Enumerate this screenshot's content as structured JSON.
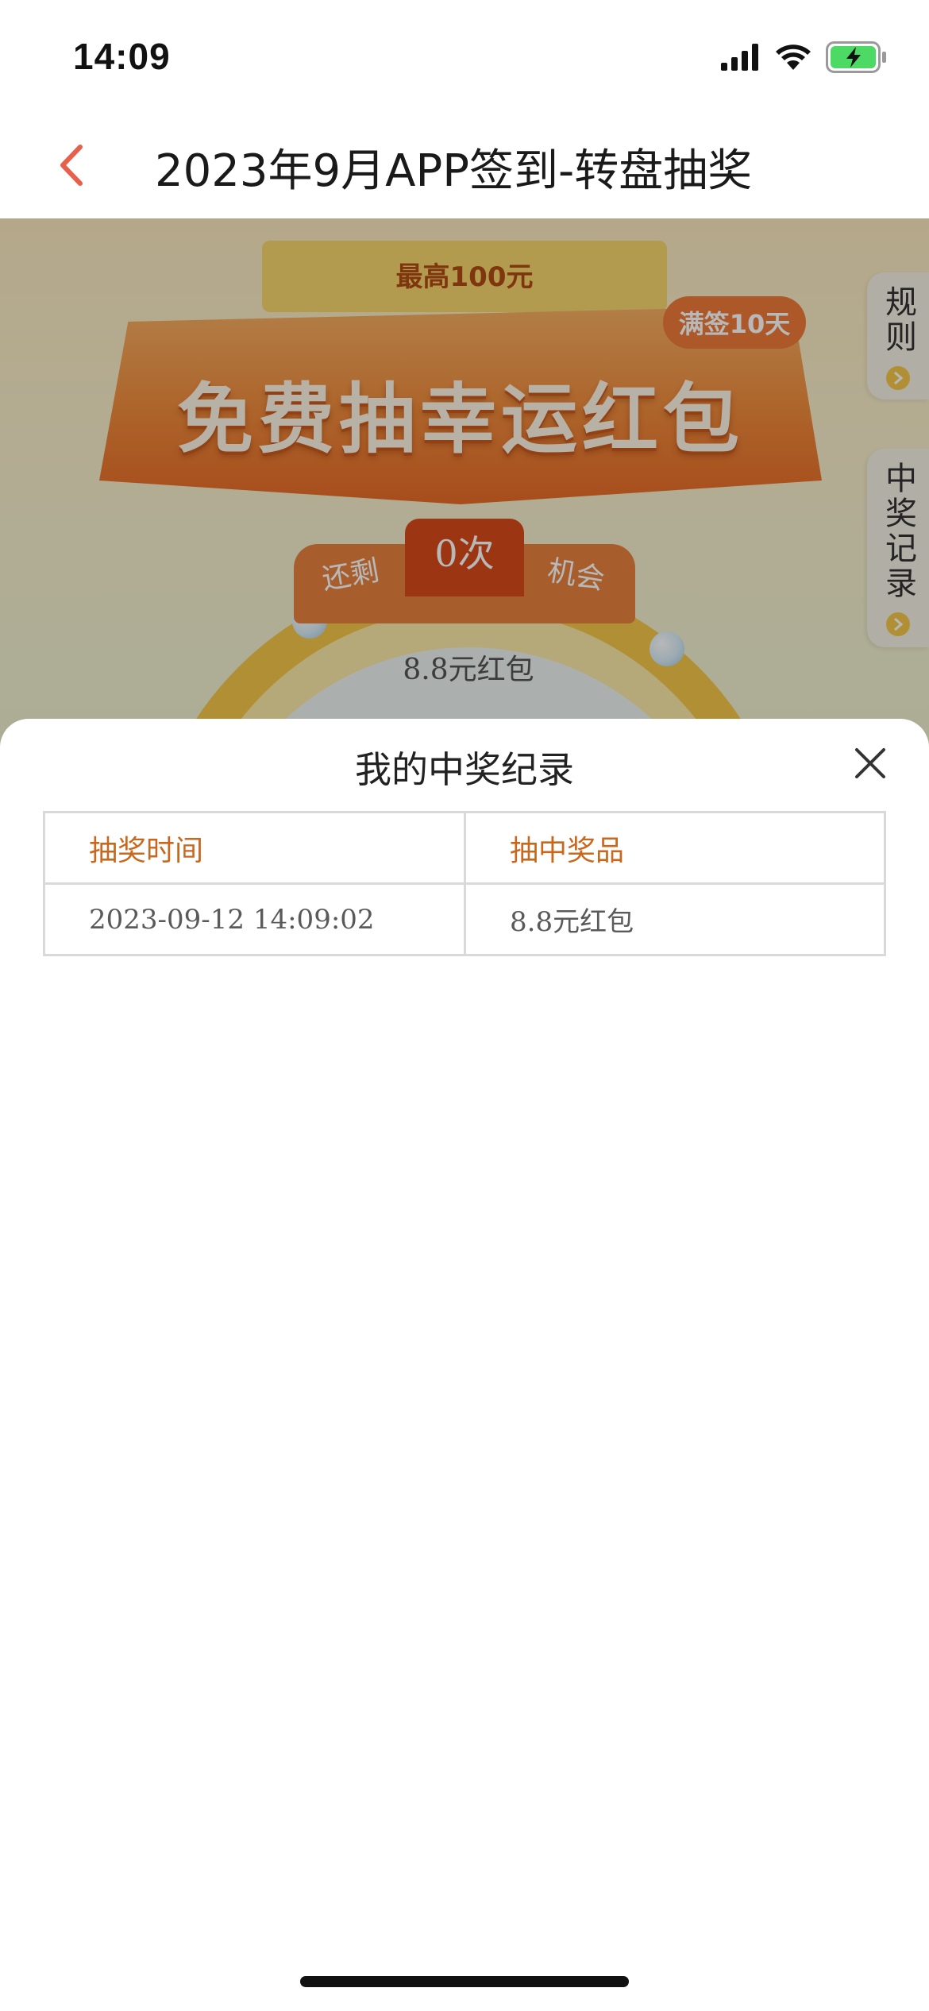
{
  "status_bar": {
    "time": "14:09",
    "icons": [
      "cellular-signal-icon",
      "wifi-icon",
      "battery-charging-icon"
    ],
    "battery_color": "#4cd964"
  },
  "nav": {
    "title": "2023年9月APP签到-转盘抽奖",
    "back_icon": "chevron-left-icon",
    "accent_color": "#e8604c"
  },
  "background_page": {
    "max_prize": "最高100元",
    "banner_title": "免费抽幸运红包",
    "signed_badge": "满签10天",
    "remaining_prefix": "还剩",
    "remaining_count": "0次",
    "remaining_suffix": "机会",
    "wheel_prize": "8.8元红包",
    "side_tabs": {
      "rules": "规则",
      "records": "中奖记录"
    }
  },
  "sheet": {
    "title": "我的中奖纪录",
    "close_icon": "close-icon",
    "columns": [
      "抽奖时间",
      "抽中奖品"
    ],
    "rows": [
      {
        "time": "2023-09-12 14:09:02",
        "prize": "8.8元红包"
      }
    ],
    "header_color": "#c9671d"
  }
}
